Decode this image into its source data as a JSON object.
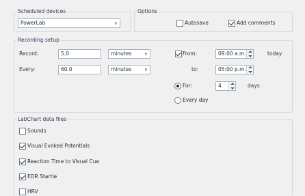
{
  "scheduled_devices": {
    "title": "Scheduled devices",
    "device_select": "PowerLab"
  },
  "options": {
    "title": "Options",
    "autosave": {
      "label": "Autosave",
      "checked": false
    },
    "add_comments": {
      "label": "Add comments",
      "checked": true
    }
  },
  "recording_setup": {
    "title": "Recording setup",
    "record": {
      "label": "Record:",
      "value": "5.0",
      "unit": "minutes"
    },
    "every": {
      "label": "Every:",
      "value": "60.0",
      "unit": "minutes"
    },
    "from": {
      "label": "From:",
      "checked": true,
      "time": "09:00 a.m.",
      "suffix": "today"
    },
    "to": {
      "label": "to:",
      "time": "05:00 p.m."
    },
    "for": {
      "label": "For:",
      "selected": true,
      "value": "4",
      "suffix": "days"
    },
    "every_day": {
      "label": "Every day",
      "selected": false
    }
  },
  "labchart_files": {
    "title": "LabChart data files",
    "items": [
      {
        "label": "Sounds",
        "checked": false
      },
      {
        "label": "Visual Evoked Potentials",
        "checked": true
      },
      {
        "label": "Reaction Time to Visual Cue",
        "checked": true
      },
      {
        "label": "EDR Startle",
        "checked": true
      },
      {
        "label": "HRV",
        "checked": false
      }
    ]
  },
  "icons": {
    "dropdown": "chevron-down-icon",
    "spin": "spin-arrows-icon"
  }
}
